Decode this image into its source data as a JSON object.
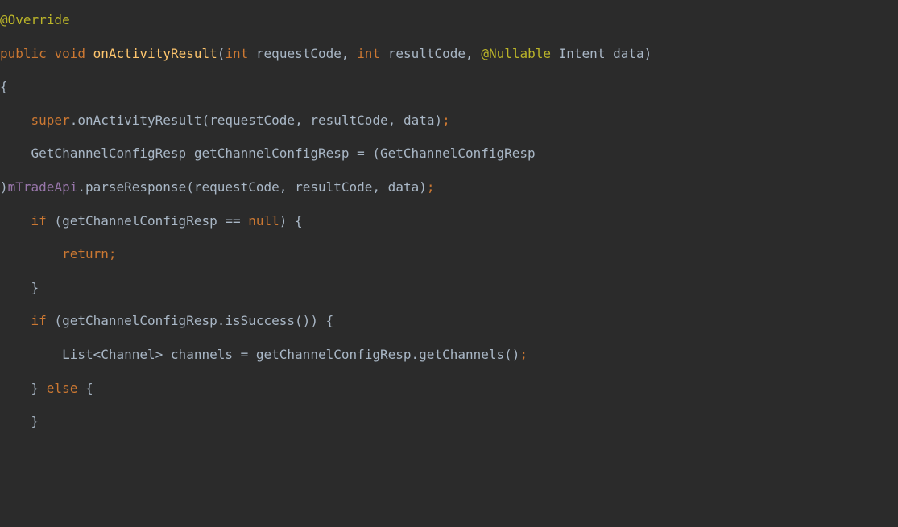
{
  "code": {
    "tokens": [
      {
        "cls": "tok-anno",
        "t": "@Override"
      },
      {
        "cls": "tok-default",
        "t": "\n"
      },
      {
        "cls": "tok-kw",
        "t": "public"
      },
      {
        "cls": "tok-default",
        "t": " "
      },
      {
        "cls": "tok-kw",
        "t": "void"
      },
      {
        "cls": "tok-default",
        "t": " "
      },
      {
        "cls": "tok-method",
        "t": "onActivityResult"
      },
      {
        "cls": "tok-paren",
        "t": "("
      },
      {
        "cls": "tok-kw",
        "t": "int"
      },
      {
        "cls": "tok-default",
        "t": " requestCode"
      },
      {
        "cls": "tok-punc",
        "t": ","
      },
      {
        "cls": "tok-default",
        "t": " "
      },
      {
        "cls": "tok-kw",
        "t": "int"
      },
      {
        "cls": "tok-default",
        "t": " resultCode"
      },
      {
        "cls": "tok-punc",
        "t": ","
      },
      {
        "cls": "tok-default",
        "t": " "
      },
      {
        "cls": "tok-anno",
        "t": "@Nullable"
      },
      {
        "cls": "tok-default",
        "t": " Intent data"
      },
      {
        "cls": "tok-paren",
        "t": ")"
      },
      {
        "cls": "tok-default",
        "t": " \n{\n    "
      },
      {
        "cls": "tok-kw",
        "t": "super"
      },
      {
        "cls": "tok-default",
        "t": ".onActivityResult(requestCode"
      },
      {
        "cls": "tok-punc",
        "t": ","
      },
      {
        "cls": "tok-default",
        "t": " resultCode"
      },
      {
        "cls": "tok-punc",
        "t": ","
      },
      {
        "cls": "tok-default",
        "t": " data)"
      },
      {
        "cls": "tok-kw",
        "t": ";"
      },
      {
        "cls": "tok-default",
        "t": "\n    GetChannelConfigResp getChannelConfigResp = (GetChannelConfigResp\n)"
      },
      {
        "cls": "tok-field",
        "t": "mTradeApi"
      },
      {
        "cls": "tok-default",
        "t": ".parseResponse(requestCode"
      },
      {
        "cls": "tok-punc",
        "t": ","
      },
      {
        "cls": "tok-default",
        "t": " resultCode"
      },
      {
        "cls": "tok-punc",
        "t": ","
      },
      {
        "cls": "tok-default",
        "t": " data)"
      },
      {
        "cls": "tok-kw",
        "t": ";"
      },
      {
        "cls": "tok-default",
        "t": "\n    "
      },
      {
        "cls": "tok-kw",
        "t": "if"
      },
      {
        "cls": "tok-default",
        "t": " (getChannelConfigResp == "
      },
      {
        "cls": "tok-kw",
        "t": "null"
      },
      {
        "cls": "tok-default",
        "t": ") {\n        "
      },
      {
        "cls": "tok-kw",
        "t": "return;"
      },
      {
        "cls": "tok-default",
        "t": "\n    }\n    "
      },
      {
        "cls": "tok-kw",
        "t": "if"
      },
      {
        "cls": "tok-default",
        "t": " (getChannelConfigResp.isSuccess()) {\n        List<Channel> channels = getChannelConfigResp.getChannels()"
      },
      {
        "cls": "tok-kw",
        "t": ";"
      },
      {
        "cls": "tok-default",
        "t": "\n    } "
      },
      {
        "cls": "tok-kw",
        "t": "else"
      },
      {
        "cls": "tok-default",
        "t": " {\n    }"
      }
    ]
  }
}
